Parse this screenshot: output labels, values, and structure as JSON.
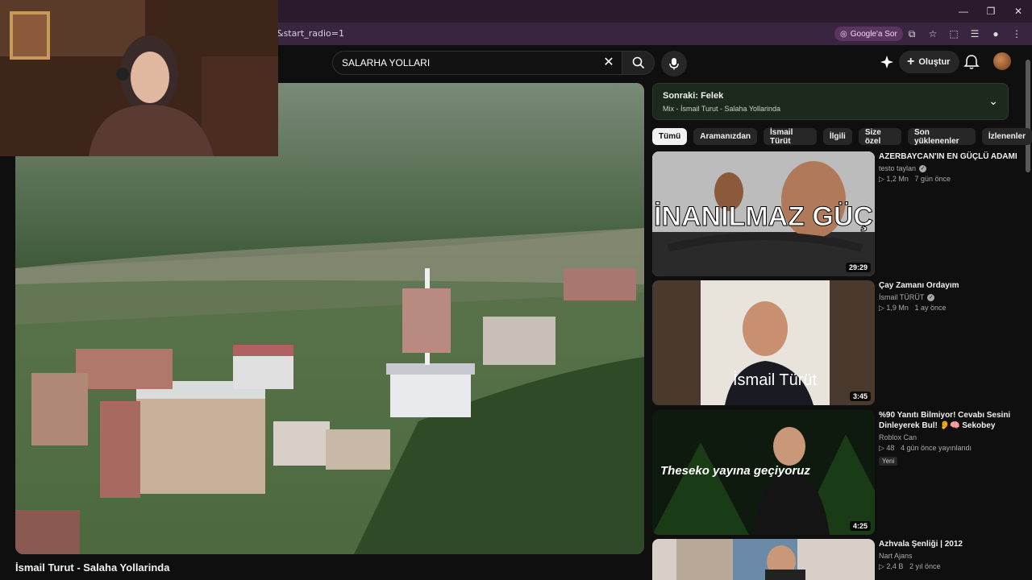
{
  "browser": {
    "url": "&start_radio=1",
    "google_sor": "Google'a Sor",
    "window_controls": [
      "—",
      "❐",
      "✕"
    ]
  },
  "youtube": {
    "search_query": "SALARHA YOLLARI",
    "create_label": "Oluştur"
  },
  "player": {
    "video_title": "İsmail Turut - Salaha Yollarinda"
  },
  "up_next": {
    "title": "Sonraki: Felek",
    "subtitle": "Mix - İsmail Turut - Salaha Yollarinda"
  },
  "chips": [
    "Tümü",
    "Aramanızdan",
    "İsmail Türüt",
    "İlgili",
    "Size özel",
    "Son yüklenenler",
    "İzlenenler"
  ],
  "recommendations": [
    {
      "title": "AZERBAYCAN'IN EN GÜÇLÜ ADAMI",
      "channel": "testo taylan",
      "verified": true,
      "views": "1,2 Mn",
      "age": "7 gün önce",
      "duration": "29:29",
      "thumb_text": "İNANILMAZ GÜÇ",
      "badge": ""
    },
    {
      "title": "Çay Zamanı Ordayım",
      "channel": "İsmail TÜRÜT",
      "verified": true,
      "views": "1,9 Mn",
      "age": "1 ay önce",
      "duration": "3:45",
      "thumb_text": "İsmail Türüt",
      "badge": ""
    },
    {
      "title": "%90 Yanıtı Bilmiyor! Cevabı Sesini Dinleyerek Bul! 👂🧠 Sekobey",
      "channel": "Roblox Can",
      "verified": false,
      "views": "48",
      "age": "4 gün önce yayınlandı",
      "duration": "4:25",
      "thumb_text": "Theseko yayına geçiyoruz",
      "badge": "Yeni"
    },
    {
      "title": "Azhvala Şenliği | 2012",
      "channel": "Nart Ajans",
      "verified": false,
      "views": "2,4 B",
      "age": "2 yıl önce",
      "duration": "",
      "thumb_text": "",
      "badge": ""
    }
  ],
  "colors": {
    "accent": "#ff0000",
    "up_next_bg": "#1c2a1e",
    "browser_frame": "#3a2540"
  }
}
